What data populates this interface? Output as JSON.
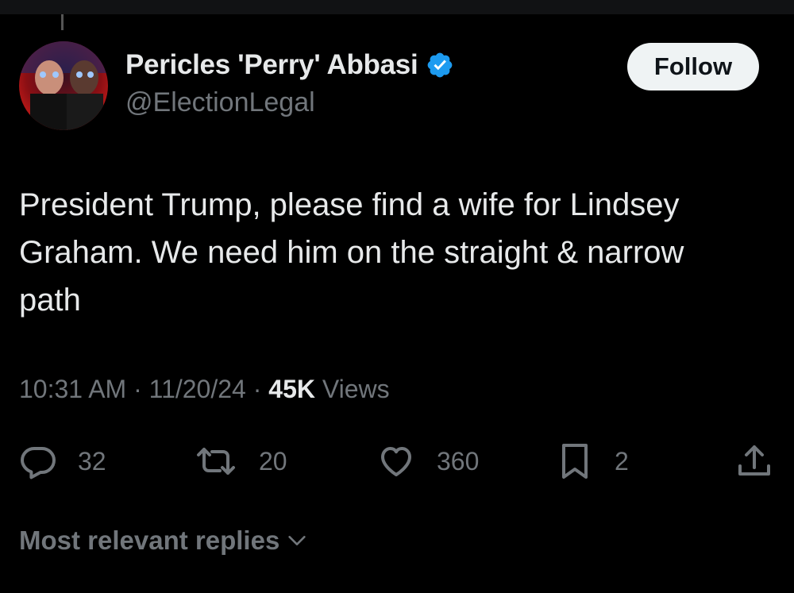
{
  "tweet": {
    "author": {
      "display_name": "Pericles 'Perry' Abbasi",
      "handle": "@ElectionLegal",
      "verified": true,
      "avatar_icon": "avatar-image"
    },
    "follow_label": "Follow",
    "text": "President Trump, please find a wife for Lindsey\nGraham. We need him on the straight & narrow\npath",
    "time": "10:31 AM",
    "date": "11/20/24",
    "separator": "·",
    "views_count": "45K",
    "views_label": "Views"
  },
  "actions": {
    "replies": {
      "icon": "reply-icon",
      "count": "32"
    },
    "retweets": {
      "icon": "retweet-icon",
      "count": "20"
    },
    "likes": {
      "icon": "heart-icon",
      "count": "360"
    },
    "bookmarks": {
      "icon": "bookmark-icon",
      "count": "2"
    },
    "share": {
      "icon": "share-icon"
    }
  },
  "replies_sort": {
    "label": "Most relevant replies",
    "icon": "chevron-down-icon"
  },
  "colors": {
    "background": "#000000",
    "text_primary": "#e7e9ea",
    "text_secondary": "#71767b",
    "verified_blue": "#1d9bf0",
    "follow_button_bg": "#eff3f4"
  }
}
